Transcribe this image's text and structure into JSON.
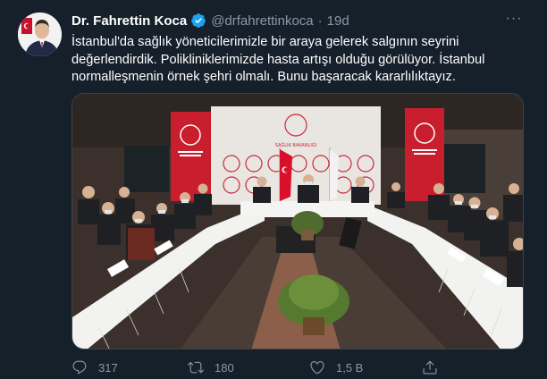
{
  "tweet": {
    "author_name": "Dr. Fahrettin Koca",
    "handle": "@drfahrettinkoca",
    "separator": "·",
    "time": "19d",
    "text": "İstanbul'da sağlık yöneticilerimizle bir araya gelerek salgının seyrini\ndeğerlendirdik. Polikliniklerimizde hasta artışı olduğu görülüyor. İstanbul\nnormalleşmenin örnek şehri olmalı. Bunu başaracak kararlılıktayız.",
    "more_label": "···"
  },
  "actions": {
    "reply_count": "317",
    "retweet_count": "180",
    "like_count": "1,5 B"
  },
  "photo": {
    "sign_text": "T.C.\nSAĞLIK BAKANLIĞI"
  },
  "icons": {
    "verified": "verified-badge-icon",
    "reply": "reply-icon",
    "retweet": "retweet-icon",
    "like": "heart-icon",
    "share": "share-icon",
    "more": "more-icon"
  },
  "colors": {
    "background": "#15202b",
    "secondary_text": "#8899a6",
    "verified_blue": "#1da1f2",
    "border": "#38444d"
  }
}
